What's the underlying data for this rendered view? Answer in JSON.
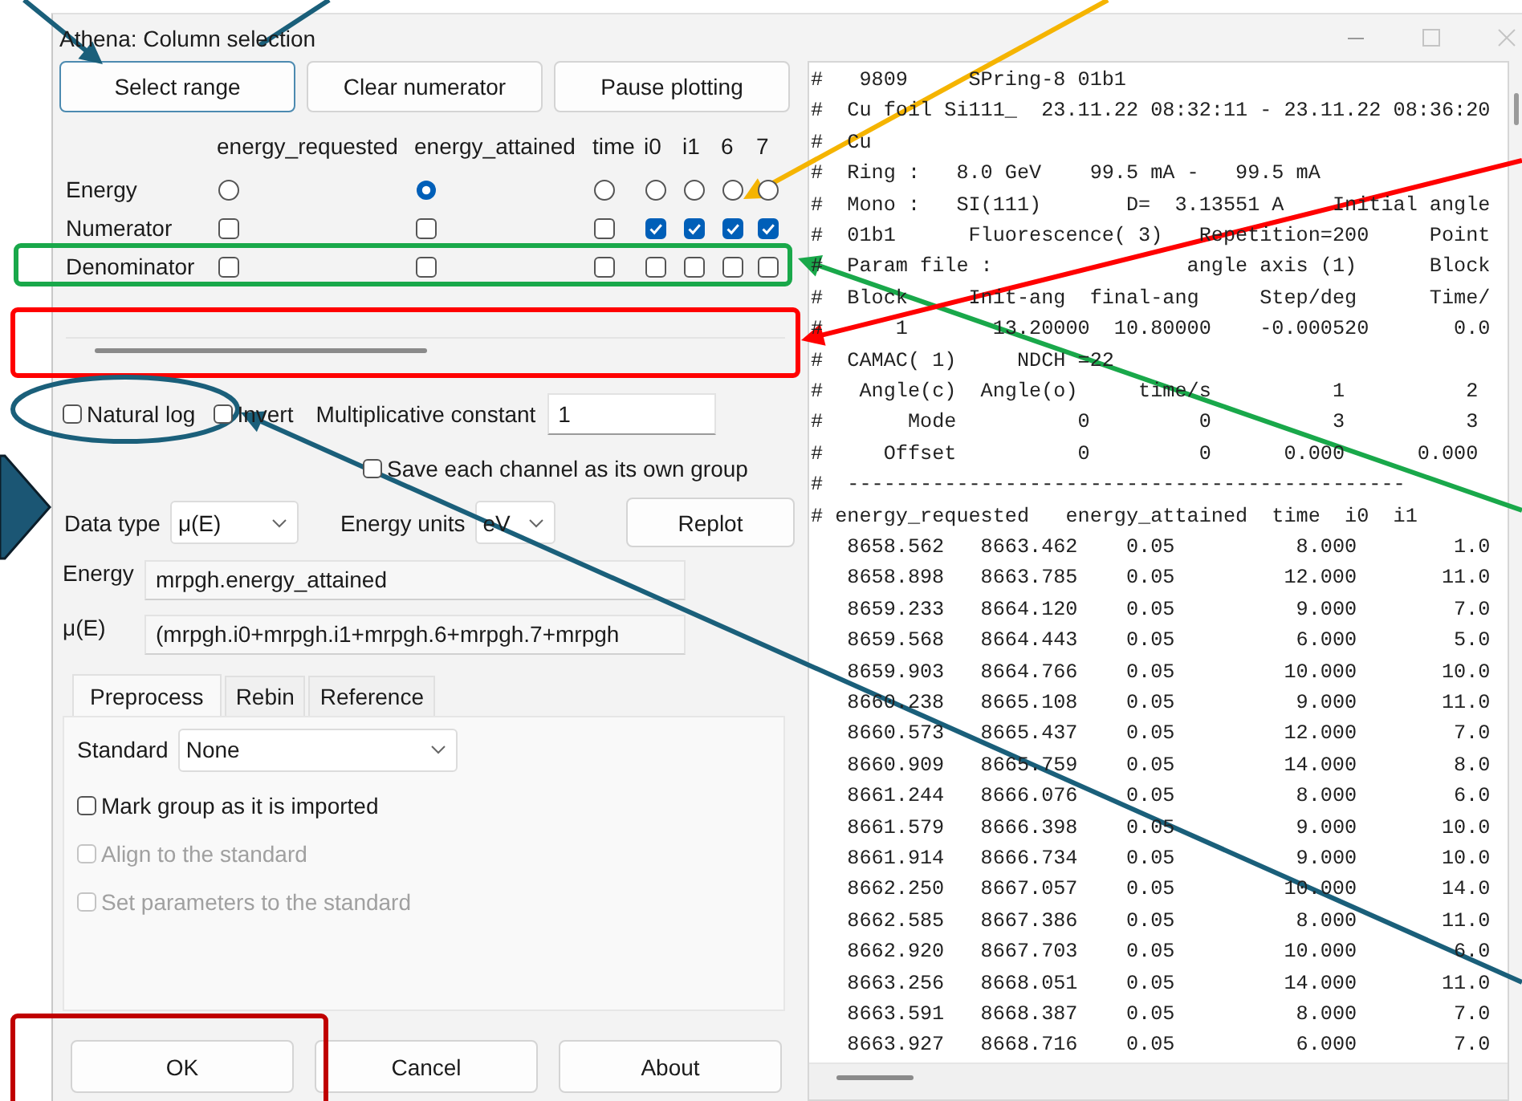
{
  "window": {
    "title": "Athena: Column selection"
  },
  "top_buttons": [
    {
      "label": "Select range",
      "focused": true
    },
    {
      "label": "Clear numerator",
      "focused": false
    },
    {
      "label": "Pause plotting",
      "focused": false
    }
  ],
  "columns": [
    "energy_requested",
    "energy_attained",
    "time",
    "i0",
    "i1",
    "6",
    "7"
  ],
  "selection_rows": [
    {
      "label": "Energy",
      "kind": "radio",
      "cells": [
        {
          "selected": false
        },
        {
          "selected": true
        },
        {
          "selected": false
        },
        {
          "selected": false
        },
        {
          "selected": false
        },
        {
          "selected": false
        },
        {
          "selected": false
        }
      ]
    },
    {
      "label": "Numerator",
      "kind": "checkbox",
      "cells": [
        {
          "checked": false
        },
        {
          "checked": false
        },
        {
          "checked": false
        },
        {
          "checked": true
        },
        {
          "checked": true
        },
        {
          "checked": true
        },
        {
          "checked": true
        }
      ]
    },
    {
      "label": "Denominator",
      "kind": "checkbox",
      "cells": [
        {
          "checked": false
        },
        {
          "checked": false
        },
        {
          "checked": false
        },
        {
          "checked": false
        },
        {
          "checked": false
        },
        {
          "checked": false
        },
        {
          "checked": false
        }
      ]
    }
  ],
  "options": [
    {
      "label": "Natural log",
      "checked": false
    },
    {
      "label": "Invert",
      "checked": false
    }
  ],
  "multiplicative_constant": {
    "label": "Multiplicative constant",
    "value": "1"
  },
  "save_each_channel": {
    "label": "Save each channel as its own group",
    "checked": false
  },
  "data_type": {
    "label": "Data type",
    "value": "μ(E)"
  },
  "energy_units": {
    "label": "Energy units",
    "value": "eV"
  },
  "replot_button": "Replot",
  "energy_field": {
    "label": "Energy",
    "value": "mrpgh.energy_attained"
  },
  "mu_field": {
    "label": "μ(E)",
    "value": "(mrpgh.i0+mrpgh.i1+mrpgh.6+mrpgh.7+mrpgh"
  },
  "tabs": [
    {
      "label": "Preprocess",
      "selected": true
    },
    {
      "label": "Rebin",
      "selected": false
    },
    {
      "label": "Reference",
      "selected": false
    }
  ],
  "preprocess": {
    "standard": {
      "label": "Standard",
      "value": "None"
    },
    "checkboxes": [
      {
        "label": "Mark group as it is imported",
        "checked": false,
        "disabled": false
      },
      {
        "label": "Align to the standard",
        "checked": false,
        "disabled": true
      },
      {
        "label": "Set parameters to the standard",
        "checked": false,
        "disabled": true
      }
    ]
  },
  "dialog_buttons": [
    "OK",
    "Cancel",
    "About"
  ],
  "file_view": {
    "header_lines": [
      "#   9809     SPring-8 01b1",
      "#  Cu foil Si111_  23.11.22 08:32:11 - 23.11.22 08:36:20",
      "#  Cu",
      "#  Ring :   8.0 GeV    99.5 mA -   99.5 mA",
      "#  Mono :   SI(111)       D=  3.13551 A    Initial angle",
      "#  01b1      Fluorescence( 3)   Repetition=200     Point",
      "#  Param file :                angle axis (1)      Block",
      "#  Block     Init-ang  final-ang     Step/deg      Time/",
      "#      1       13.20000  10.80000    -0.000520       0.0",
      "#  CAMAC( 1)     NDCH =22",
      "#   Angle(c)  Angle(o)     time/s          1          2",
      "#       Mode          0         0          3          3",
      "#     Offset          0         0      0.000      0.000",
      "#  ----------------------------------------------",
      "# energy_requested   energy_attained  time  i0  i1"
    ],
    "rows": [
      [
        "8658.562",
        "8663.462",
        "0.05",
        "8.000",
        "1.0"
      ],
      [
        "8658.898",
        "8663.785",
        "0.05",
        "12.000",
        "11.0"
      ],
      [
        "8659.233",
        "8664.120",
        "0.05",
        "9.000",
        "7.0"
      ],
      [
        "8659.568",
        "8664.443",
        "0.05",
        "6.000",
        "5.0"
      ],
      [
        "8659.903",
        "8664.766",
        "0.05",
        "10.000",
        "10.0"
      ],
      [
        "8660.238",
        "8665.108",
        "0.05",
        "9.000",
        "11.0"
      ],
      [
        "8660.573",
        "8665.437",
        "0.05",
        "12.000",
        "7.0"
      ],
      [
        "8660.909",
        "8665.759",
        "0.05",
        "14.000",
        "8.0"
      ],
      [
        "8661.244",
        "8666.076",
        "0.05",
        "8.000",
        "6.0"
      ],
      [
        "8661.579",
        "8666.398",
        "0.05",
        "9.000",
        "10.0"
      ],
      [
        "8661.914",
        "8666.734",
        "0.05",
        "9.000",
        "10.0"
      ],
      [
        "8662.250",
        "8667.057",
        "0.05",
        "10.000",
        "14.0"
      ],
      [
        "8662.585",
        "8667.386",
        "0.05",
        "8.000",
        "11.0"
      ],
      [
        "8662.920",
        "8667.703",
        "0.05",
        "10.000",
        "6.0"
      ],
      [
        "8663.256",
        "8668.051",
        "0.05",
        "14.000",
        "11.0"
      ],
      [
        "8663.591",
        "8668.387",
        "0.05",
        "8.000",
        "7.0"
      ],
      [
        "8663.927",
        "8668.716",
        "0.05",
        "6.000",
        "7.0"
      ]
    ]
  },
  "annotations": [
    {
      "kind": "arrow",
      "color": "#1a5f7a"
    },
    {
      "kind": "line",
      "color": "#1a5f7a"
    },
    {
      "kind": "arrow",
      "color": "#f5b400"
    },
    {
      "kind": "box",
      "color": "#19a84a"
    },
    {
      "kind": "arrow",
      "color": "#19a84a"
    },
    {
      "kind": "box",
      "color": "#ff0000"
    },
    {
      "kind": "arrow",
      "color": "#ff0000"
    },
    {
      "kind": "ellipse",
      "color": "#1a5f7a"
    },
    {
      "kind": "arrow",
      "color": "#1a5f7a"
    },
    {
      "kind": "block-arrow",
      "color": "#1b5674"
    },
    {
      "kind": "box",
      "color": "#c00000"
    }
  ]
}
